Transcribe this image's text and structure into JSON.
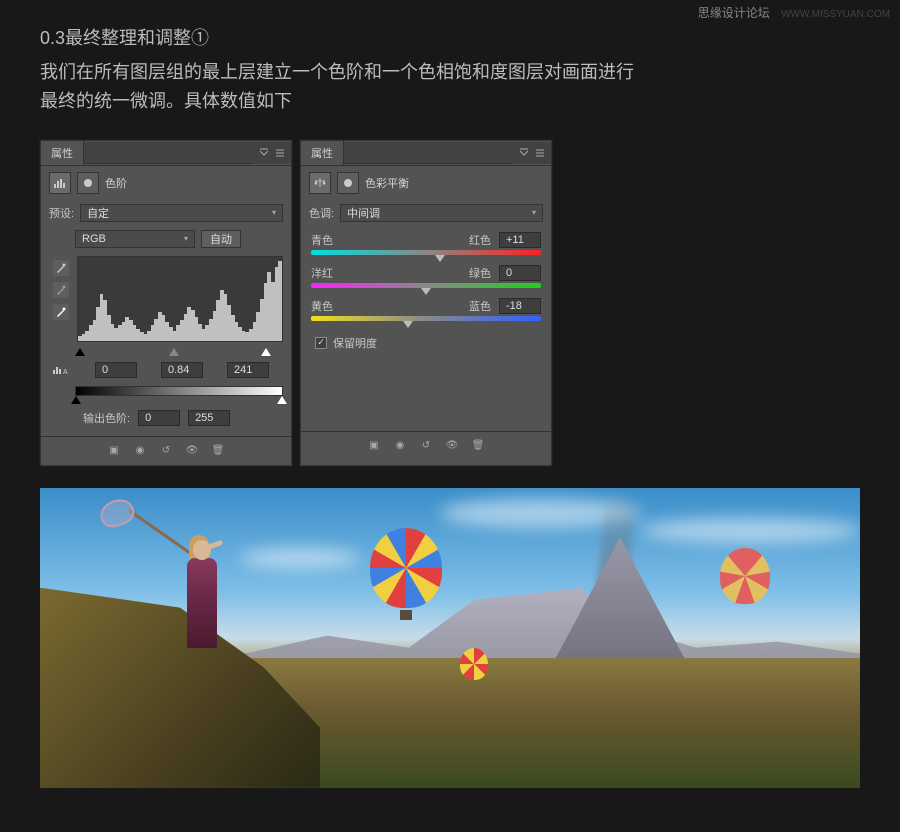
{
  "watermark": {
    "main": "思缘设计论坛",
    "url": "WWW.MISSYUAN.COM"
  },
  "header": {
    "title": "0.3最终整理和调整①",
    "desc_l1": "我们在所有图层组的最上层建立一个色阶和一个色相饱和度图层对画面进行",
    "desc_l2": "最终的统一微调。具体数值如下"
  },
  "panel_levels": {
    "tab": "属性",
    "icon_levels": "levels-icon",
    "icon_mask": "mask-icon",
    "adj_name": "色阶",
    "preset_label": "预设:",
    "preset_value": "自定",
    "channel_value": "RGB",
    "auto_btn": "自动",
    "in_black": "0",
    "in_gamma": "0.84",
    "in_white": "241",
    "out_label": "输出色阶:",
    "out_black": "0",
    "out_white": "255"
  },
  "panel_cb": {
    "tab": "属性",
    "icon_cb": "balance-icon",
    "icon_mask": "mask-icon",
    "adj_name": "色彩平衡",
    "tone_label": "色调:",
    "tone_value": "中间调",
    "row1": {
      "left": "青色",
      "right": "红色",
      "value": "+11"
    },
    "row2": {
      "left": "洋红",
      "right": "绿色",
      "value": "0"
    },
    "row3": {
      "left": "黄色",
      "right": "蓝色",
      "value": "-18"
    },
    "checkbox_label": "保留明度"
  }
}
